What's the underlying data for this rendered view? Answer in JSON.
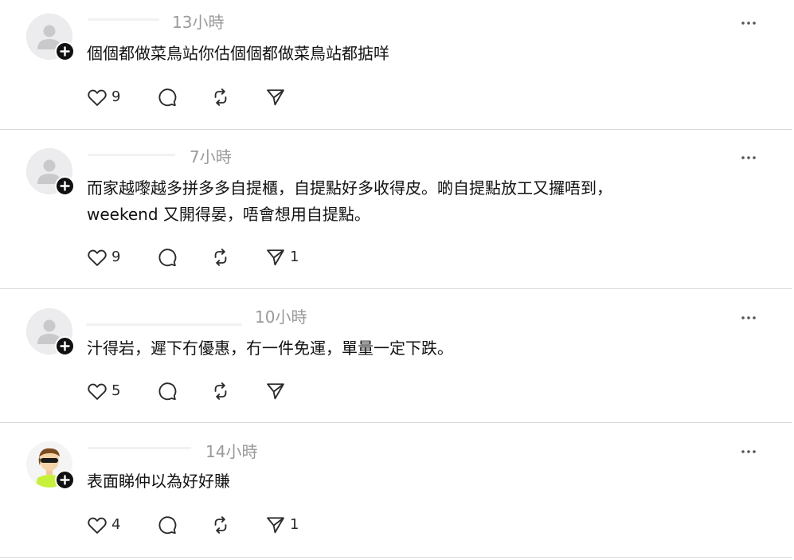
{
  "colors": {
    "background": "#ffffff",
    "divider": "#d9d9d9",
    "timestamp": "#9a9a9a",
    "text": "#111111",
    "icon": "#2a2a2a",
    "follow_badge": "#111111"
  },
  "posts": [
    {
      "avatar_icon": "default-user-avatar",
      "timestamp": "13小時",
      "text_lines": [
        "個個都做菜鳥站你估個個都做菜鳥站都掂咩"
      ],
      "likes": "9",
      "comments": "",
      "reposts": "",
      "shares": ""
    },
    {
      "avatar_icon": "default-user-avatar",
      "timestamp": "7小時",
      "text_lines": [
        "而家越嚟越多拼多多自提櫃，自提點好多收得皮。啲自提點放工又攞唔到，",
        "weekend 又開得晏，唔會想用自提點。"
      ],
      "likes": "9",
      "comments": "",
      "reposts": "",
      "shares": "1"
    },
    {
      "avatar_icon": "default-user-avatar",
      "timestamp": "10小時",
      "text_lines": [
        "汁得岩，遲下冇優惠，冇一件免運，單量一定下跌。"
      ],
      "likes": "5",
      "comments": "",
      "reposts": "",
      "shares": ""
    },
    {
      "avatar_icon": "cartoon-character-avatar",
      "timestamp": "14小時",
      "text_lines": [
        "表面睇仲以為好好賺"
      ],
      "likes": "4",
      "comments": "",
      "reposts": "",
      "shares": "1"
    }
  ]
}
